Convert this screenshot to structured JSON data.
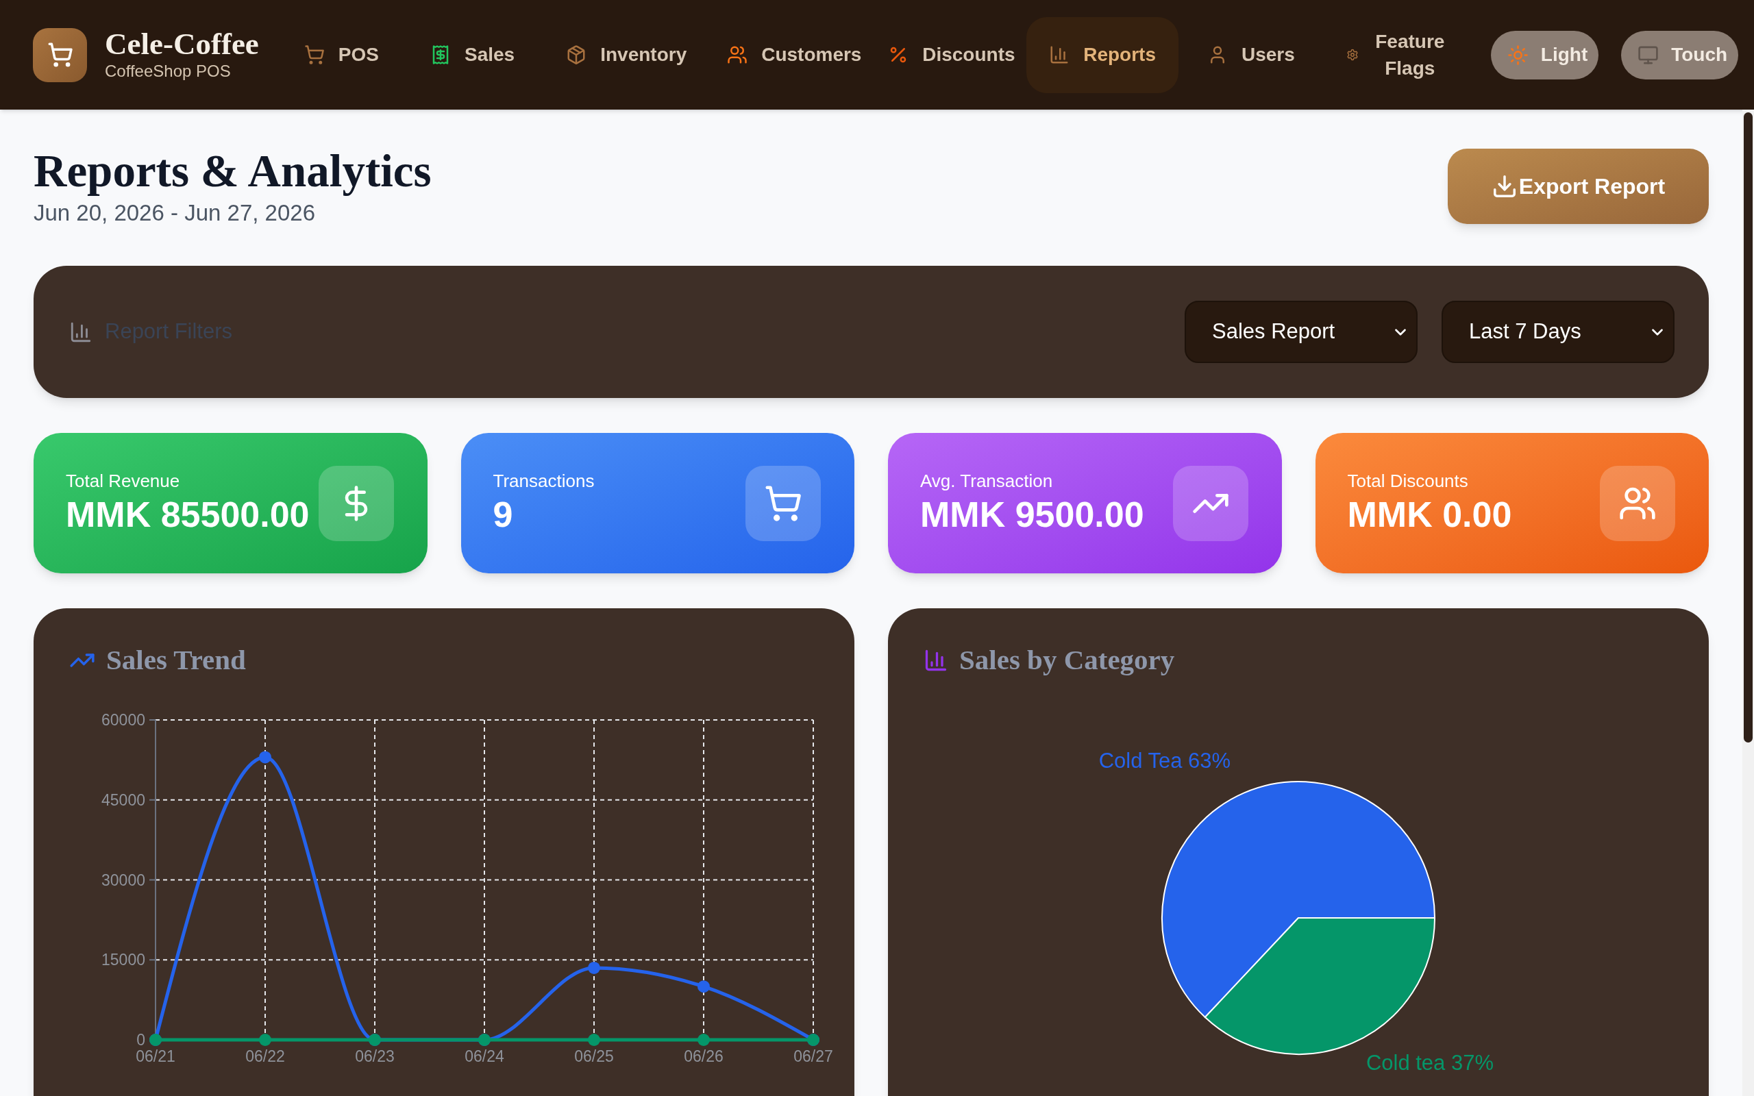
{
  "nav": {
    "brand": {
      "name": "Cele-Coffee",
      "subtitle": "CoffeeShop POS"
    },
    "items": [
      {
        "label": "POS",
        "selected": false
      },
      {
        "label": "Sales",
        "selected": false
      },
      {
        "label": "Inventory",
        "selected": false
      },
      {
        "label": "Customers",
        "selected": false
      },
      {
        "label": "Discounts",
        "selected": false
      },
      {
        "label": "Reports",
        "selected": true
      },
      {
        "label": "Users",
        "selected": false
      },
      {
        "label": "Feature Flags",
        "selected": false
      }
    ],
    "toggles": [
      {
        "label": "Light"
      },
      {
        "label": "Touch"
      }
    ]
  },
  "header": {
    "title": "Reports & Analytics",
    "date_range": "Jun 20, 2026 - Jun 27, 2026",
    "export_button": "Export Report"
  },
  "filters": {
    "title": "Report Filters",
    "selects": [
      {
        "value": "Sales Report"
      },
      {
        "value": "Last 7 Days"
      }
    ]
  },
  "stats": [
    {
      "label": "Total Revenue",
      "value": "MMK 85500.00"
    },
    {
      "label": "Transactions",
      "value": "9"
    },
    {
      "label": "Avg. Transaction",
      "value": "MMK 9500.00"
    },
    {
      "label": "Total Discounts",
      "value": "MMK 0.00"
    }
  ],
  "sales_trend": {
    "title": "Sales Trend",
    "chart_data": {
      "type": "line",
      "categories": [
        "06/21",
        "06/22",
        "06/23",
        "06/24",
        "06/25",
        "06/26",
        "06/27"
      ],
      "series": [
        {
          "color": "#2563eb",
          "values": [
            0,
            53000,
            0,
            0,
            13500,
            10000,
            0
          ]
        },
        {
          "color": "#059669",
          "values": [
            0,
            0,
            0,
            0,
            0,
            0,
            0
          ]
        }
      ],
      "ylim": [
        0,
        60000
      ],
      "yticks": [
        0,
        15000,
        30000,
        45000,
        60000
      ],
      "grid": true,
      "marker": "circle"
    }
  },
  "sales_by_category": {
    "title": "Sales by Category",
    "chart_data": {
      "type": "pie",
      "categories": [
        "Cold Tea",
        "Cold tea"
      ],
      "values": [
        63,
        37
      ],
      "colors": [
        "#2563eb",
        "#059669"
      ],
      "value_labels": [
        "63%",
        "37%"
      ]
    }
  }
}
